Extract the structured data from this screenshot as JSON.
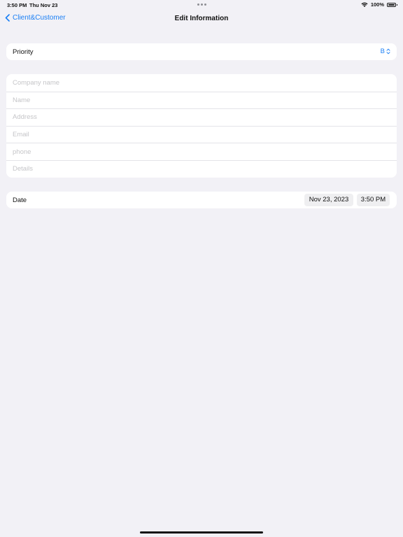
{
  "status_bar": {
    "time": "3:50 PM",
    "date": "Thu Nov 23",
    "battery": "100%",
    "icons": [
      "wifi-icon",
      "battery-icon"
    ]
  },
  "nav": {
    "back_label": "Client&Customer",
    "title": "Edit Information"
  },
  "priority": {
    "label": "Priority",
    "value": "B"
  },
  "form": {
    "company_placeholder": "Company name",
    "name_placeholder": "Name",
    "address_placeholder": "Address",
    "email_placeholder": "Email",
    "phone_placeholder": "phone",
    "details_placeholder": "Details"
  },
  "date_row": {
    "label": "Date",
    "date_value": "Nov 23, 2023",
    "time_value": "3:50 PM"
  },
  "colors": {
    "accent": "#1a7ff5",
    "background": "#f2f1f6",
    "card": "#ffffff"
  }
}
